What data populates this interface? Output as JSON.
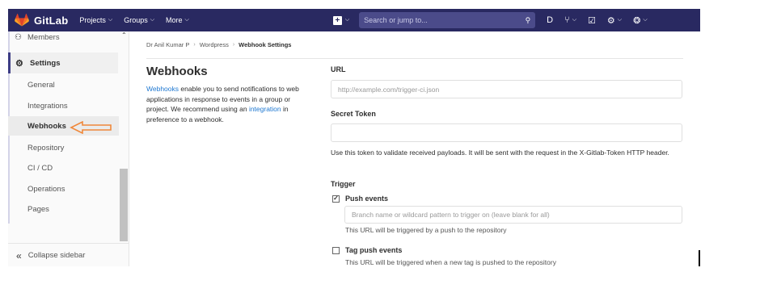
{
  "navbar": {
    "brand": "GitLab",
    "projects": "Projects",
    "groups": "Groups",
    "more": "More",
    "search_placeholder": "Search or jump to...",
    "brand_color": "#292961",
    "logo_color": "#e24329"
  },
  "sidebar": {
    "members": "Members",
    "settings": "Settings",
    "items": [
      "General",
      "Integrations",
      "Webhooks",
      "Repository",
      "CI / CD",
      "Operations",
      "Pages"
    ],
    "active": "Webhooks",
    "collapse": "Collapse sidebar"
  },
  "breadcrumb": {
    "user": "Dr Anil Kumar P",
    "project": "Wordpress",
    "current": "Webhook Settings"
  },
  "page": {
    "title": "Webhooks",
    "desc_link": "Webhooks",
    "desc_text1": " enable you to send notifications to web applications in response to events in a group or project. We recommend using an ",
    "desc_link2": "integration",
    "desc_text2": " in preference to a webhook."
  },
  "form": {
    "url_label": "URL",
    "url_placeholder": "http://example.com/trigger-ci.json",
    "secret_label": "Secret Token",
    "secret_help": "Use this token to validate received payloads. It will be sent with the request in the X-Gitlab-Token HTTP header.",
    "trigger_label": "Trigger",
    "push_events": "Push events",
    "push_checked": true,
    "branch_placeholder": "Branch name or wildcard pattern to trigger on (leave blank for all)",
    "push_help": "This URL will be triggered by a push to the repository",
    "tag_push_events": "Tag push events",
    "tag_checked": false,
    "tag_help": "This URL will be triggered when a new tag is pushed to the repository"
  },
  "annotation": {
    "arrow_color": "#f0883a"
  }
}
